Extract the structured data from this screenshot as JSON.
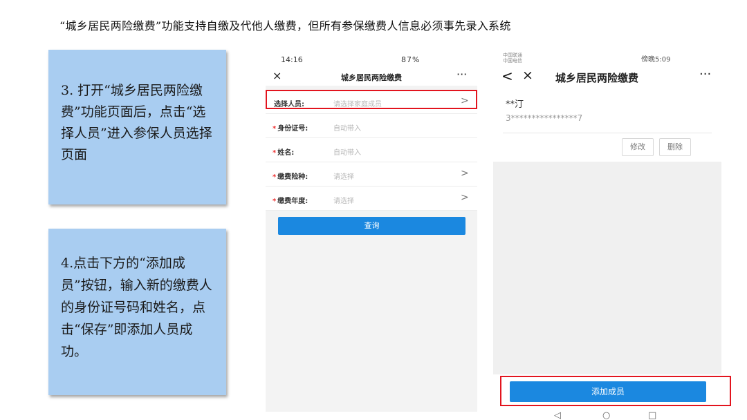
{
  "header": {
    "text": "“城乡居民两险缴费”功能支持自缴及代他人缴费，但所有参保缴费人信息必须事先录入系统"
  },
  "notes": {
    "step3": "3. 打开“城乡居民两险缴费”功能页面后，点击“选择人员”进入参保人员选择页面",
    "step4": "4.点击下方的“添加成员”按钮，输入新的缴费人的身份证号码和姓名，点击“保存”即添加人员成功。"
  },
  "phone1": {
    "status": {
      "time": "14:16",
      "right": "87%"
    },
    "title": "城乡居民两险缴费",
    "close_icon": "×",
    "more_icon": "···",
    "rows": [
      {
        "label": "选择人员:",
        "value": "请选择家庭成员",
        "required": "",
        "arrow": ">"
      },
      {
        "label": "身份证号:",
        "value": "自动带入",
        "required": "*",
        "arrow": ""
      },
      {
        "label": "姓名:",
        "value": "自动带入",
        "required": "*",
        "arrow": ""
      },
      {
        "label": "缴费险种:",
        "value": "请选择",
        "required": "*",
        "arrow": ">"
      },
      {
        "label": "缴费年度:",
        "value": "请选择",
        "required": "*",
        "arrow": ">"
      }
    ],
    "query_button": "查询"
  },
  "phone2": {
    "status": {
      "left_line1": "中国联通",
      "left_line2": "中国电信",
      "right": "傍晚5:09"
    },
    "title": "城乡居民两险缴费",
    "back_icon": "<",
    "close_icon": "×",
    "more_icon": "···",
    "member": {
      "name": "**汀",
      "id": "3****************7"
    },
    "edit_button": "修改",
    "delete_button": "删除",
    "add_button": "添加成员",
    "nav": {
      "back": "◁",
      "home": "○",
      "recent": "□"
    }
  },
  "colors": {
    "accent": "#1b88e0",
    "highlight": "#e2141e",
    "note_bg": "#a9cdf1"
  }
}
